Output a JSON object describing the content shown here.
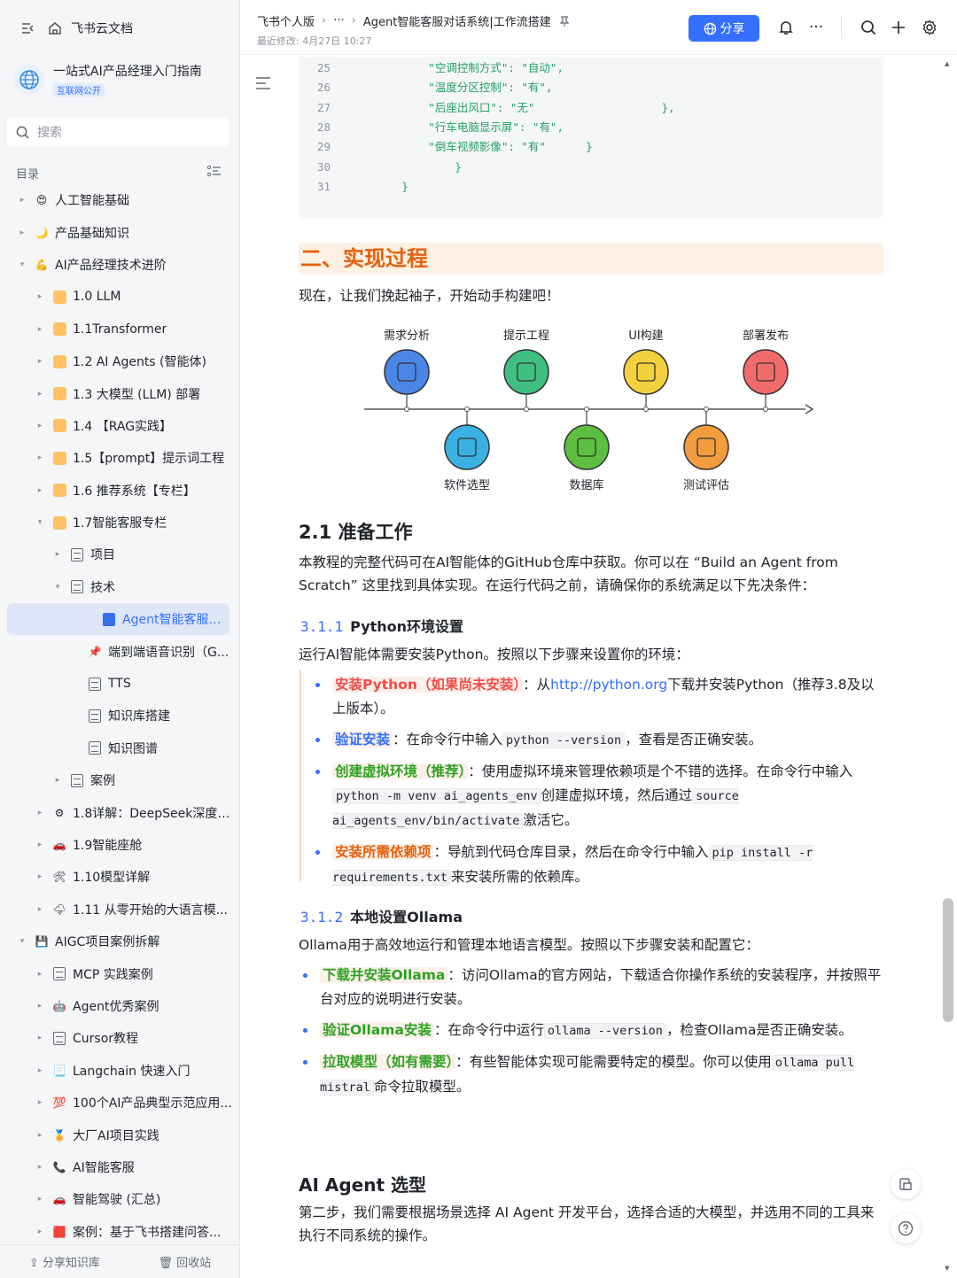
{
  "sidebar": {
    "app_title": "飞书云文档",
    "kb_title": "一站式AI产品经理入门指南",
    "kb_tag": "互联网公开",
    "search_placeholder": "搜索",
    "toc_label": "目录",
    "items": [
      {
        "label": "人工智能基础",
        "level": 0,
        "arrow": "▸",
        "icon": "heart-eyes-emoji"
      },
      {
        "label": "产品基础知识",
        "level": 0,
        "arrow": "▸",
        "icon": "crescent-moon-emoji"
      },
      {
        "label": "AI产品经理技术进阶",
        "level": 0,
        "arrow": "▾",
        "icon": "flexed-biceps-emoji"
      },
      {
        "label": "1.0 LLM",
        "level": 1,
        "arrow": "▸",
        "icon": "orange-square-icon"
      },
      {
        "label": "1.1Transformer",
        "level": 1,
        "arrow": "▸",
        "icon": "orange-square-icon"
      },
      {
        "label": "1.2 AI Agents (智能体)",
        "level": 1,
        "arrow": "▸",
        "icon": "orange-square-icon"
      },
      {
        "label": "1.3 大模型 (LLM) 部署",
        "level": 1,
        "arrow": "▸",
        "icon": "orange-square-icon"
      },
      {
        "label": "1.4 【RAG实践】",
        "level": 1,
        "arrow": "▸",
        "icon": "orange-square-icon"
      },
      {
        "label": "1.5【prompt】提示词工程",
        "level": 1,
        "arrow": "▸",
        "icon": "orange-square-icon"
      },
      {
        "label": "1.6 推荐系统【专栏】",
        "level": 1,
        "arrow": "▸",
        "icon": "orange-square-icon"
      },
      {
        "label": "1.7智能客服专栏",
        "level": 1,
        "arrow": "▾",
        "icon": "orange-square-icon"
      },
      {
        "label": "项目",
        "level": 2,
        "arrow": "▸",
        "icon": "doc-icon"
      },
      {
        "label": "技术",
        "level": 2,
        "arrow": "▾",
        "icon": "doc-icon"
      },
      {
        "label": "Agent智能客服对话...",
        "level": 3,
        "arrow": "",
        "icon": "doc-blue-icon",
        "selected": true
      },
      {
        "label": "端到端语音识别（G...",
        "level": 3,
        "arrow": "",
        "icon": "pushpin-emoji"
      },
      {
        "label": "TTS",
        "level": 3,
        "arrow": "",
        "icon": "doc-icon"
      },
      {
        "label": "知识库搭建",
        "level": 3,
        "arrow": "",
        "icon": "doc-icon"
      },
      {
        "label": "知识图谱",
        "level": 3,
        "arrow": "",
        "icon": "doc-icon"
      },
      {
        "label": "案例",
        "level": 2,
        "arrow": "▸",
        "icon": "doc-icon"
      },
      {
        "label": "1.8详解：DeepSeek深度推...",
        "level": 1,
        "arrow": "▸",
        "icon": "gear-emoji"
      },
      {
        "label": "1.9智能座舱",
        "level": 1,
        "arrow": "▸",
        "icon": "car-emoji"
      },
      {
        "label": "1.10模型详解",
        "level": 1,
        "arrow": "▸",
        "icon": "tools-emoji"
      },
      {
        "label": "1.11 从零开始的大语言模...",
        "level": 1,
        "arrow": "▸",
        "icon": "lightning-cloud-emoji"
      },
      {
        "label": "AIGC项目案例拆解",
        "level": 0,
        "arrow": "▾",
        "icon": "floppy-disk-emoji"
      },
      {
        "label": "MCP 实践案例",
        "level": 1,
        "arrow": "▸",
        "icon": "doc-icon"
      },
      {
        "label": "Agent优秀案例",
        "level": 1,
        "arrow": "▸",
        "icon": "robot-emoji"
      },
      {
        "label": "Cursor教程",
        "level": 1,
        "arrow": "▸",
        "icon": "doc-icon"
      },
      {
        "label": "Langchain 快速入门",
        "level": 1,
        "arrow": "▸",
        "icon": "page-emoji"
      },
      {
        "label": "100个AI产品典型示范应用...",
        "level": 1,
        "arrow": "▸",
        "icon": "hundred-emoji"
      },
      {
        "label": "大厂AI项目实践",
        "level": 1,
        "arrow": "▸",
        "icon": "medal-emoji"
      },
      {
        "label": "AI智能客服",
        "level": 1,
        "arrow": "▸",
        "icon": "phone-emoji"
      },
      {
        "label": "智能驾驶 (汇总)",
        "level": 1,
        "arrow": "▸",
        "icon": "car-emoji"
      },
      {
        "label": "案例：基于飞书搭建问答...",
        "level": 1,
        "arrow": "▸",
        "icon": "red-square-emoji"
      }
    ],
    "bottom_share": "分享知识库",
    "bottom_trash": "回收站"
  },
  "header": {
    "crumb1": "飞书个人版",
    "crumb_more": "···",
    "crumb2": "Agent智能客服对话系统|工作流搭建",
    "modified": "最近修改: 4月27日 10:27",
    "share_label": "分享"
  },
  "code": {
    "lines": [
      {
        "n": "25",
        "text": "            \"空调控制方式\": \"自动\","
      },
      {
        "n": "26",
        "text": "            \"温度分区控制\": \"有\","
      },
      {
        "n": "27",
        "text": "            \"后座出风口\": \"无\"                   },"
      },
      {
        "n": "28",
        "text": "            \"行车电脑显示屏\": \"有\","
      },
      {
        "n": "29",
        "text": "            \"倒车视频影像\": \"有\"      }"
      },
      {
        "n": "30",
        "text": "                }"
      },
      {
        "n": "31",
        "text": "        }"
      }
    ]
  },
  "content": {
    "h1": "二、实现过程",
    "intro": "现在，让我们挽起袖子，开始动手构建吧！",
    "flow": {
      "top": [
        "需求分析",
        "提示工程",
        "UI构建",
        "部署发布"
      ],
      "bottom": [
        "软件选型",
        "数据库",
        "测试评估"
      ],
      "top_colors": [
        "#4a86e8",
        "#3fbf7f",
        "#f4d03f",
        "#f26b6b"
      ],
      "bottom_colors": [
        "#3ab0e3",
        "#5cbf3f",
        "#f29b3f"
      ]
    },
    "h2_prep": "2.1 准备工作",
    "prep_p": "本教程的完整代码可在AI智能体的GitHub仓库中获取。你可以在 “Build an Agent from Scratch” 这里找到具体实现。在运行代码之前，请确保你的系统满足以下先决条件：",
    "s311_num": "3.1.1",
    "s311_title": "Python环境设置",
    "s311_p": "运行AI智能体需要安装Python。按照以下步骤来设置你的环境：",
    "b1_key": "安装Python（如果尚未安装）",
    "b1_a": "：从",
    "b1_link": "http://python.org",
    "b1_b": "下载并安装Python（推荐3.8及以上版本）。",
    "b2_key": "验证安装",
    "b2_a": "：在命令行中输入",
    "b2_code": "python --version",
    "b2_b": "，查看是否正确安装。",
    "b3_key": "创建虚拟环境（推荐）",
    "b3_a": "：使用虚拟环境来管理依赖项是个不错的选择。在命令行中输入",
    "b3_code1": "python -m venv ai_agents_env",
    "b3_b": "创建虚拟环境，然后通过",
    "b3_code2": "source ai_agents_env/bin/activate",
    "b3_c": "激活它。",
    "b4_key": "安装所需依赖项",
    "b4_a": "：导航到代码仓库目录，然后在命令行中输入",
    "b4_code": "pip install -r requirements.txt",
    "b4_b": "来安装所需的依赖库。",
    "s312_num": "3.1.2",
    "s312_title": "本地设置Ollama",
    "s312_p": "Ollama用于高效地运行和管理本地语言模型。按照以下步骤安装和配置它：",
    "c1_key": "下载并安装Ollama",
    "c1_a": "：访问Ollama的官方网站，下载适合你操作系统的安装程序，并按照平台对应的说明进行安装。",
    "c2_key": "验证Ollama安装",
    "c2_a": "：在命令行中运行",
    "c2_code": "ollama --version",
    "c2_b": "，检查Ollama是否正确安装。",
    "c3_key": "拉取模型（如有需要）",
    "c3_a": "：有些智能体实现可能需要特定的模型。你可以使用",
    "c3_code": "ollama pull mistral",
    "c3_b": "命令拉取模型。",
    "h2_agent": "AI Agent 选型",
    "agent_p": "第二步，我们需要根据场景选择 AI Agent 开发平台，选择合适的大模型，并选用不同的工具来执行不同系统的操作。"
  }
}
